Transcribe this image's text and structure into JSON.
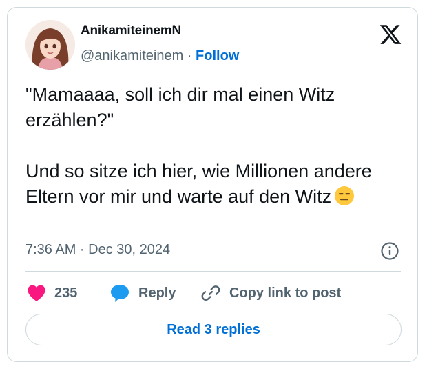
{
  "author": {
    "display_name": "AnikamiteinemN",
    "handle": "@anikamiteinem",
    "separator": " · ",
    "follow_label": "Follow"
  },
  "tweet": {
    "text": "\"Mamaaaa, soll ich dir mal einen Witz erzählen?\"\n\nUnd so sitze ich hier, wie Millionen andere Eltern vor mir und warte auf den Witz",
    "emoji": "expressionless-face-emoji",
    "timestamp": "7:36 AM · Dec 30, 2024"
  },
  "actions": {
    "like_count": "235",
    "reply_label": "Reply",
    "copy_label": "Copy link to post"
  },
  "replies_button": "Read 3 replies",
  "colors": {
    "accent": "#006fd6",
    "like": "#f91880",
    "reply_bubble": "#1d9bf0",
    "muted": "#536471",
    "border": "#cfd9de"
  }
}
